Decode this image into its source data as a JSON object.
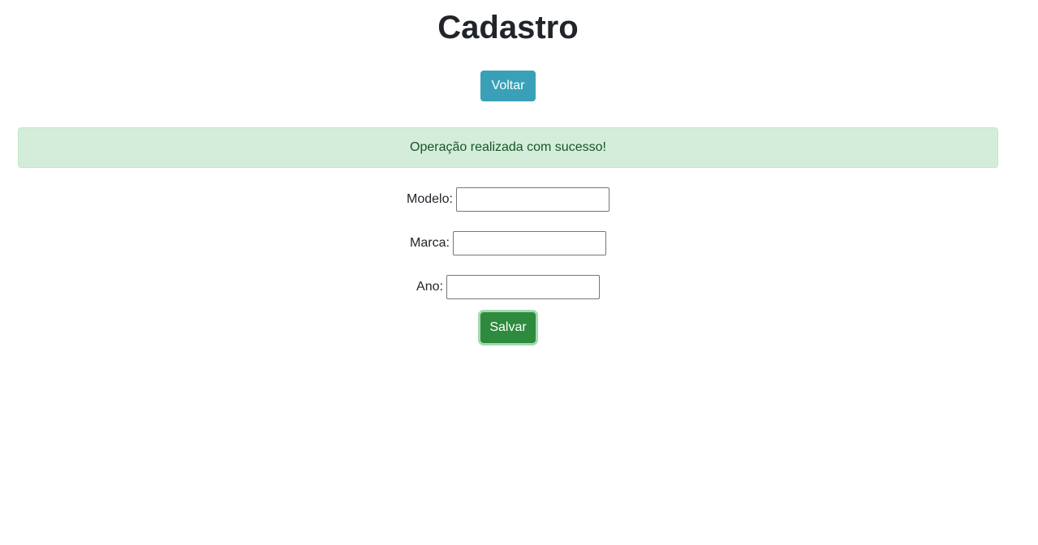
{
  "page": {
    "title": "Cadastro"
  },
  "nav": {
    "back_label": "Voltar"
  },
  "alert": {
    "message": "Operação realizada com sucesso!",
    "type": "success"
  },
  "form": {
    "fields": [
      {
        "label": "Modelo:",
        "value": ""
      },
      {
        "label": "Marca:",
        "value": ""
      },
      {
        "label": "Ano:",
        "value": ""
      }
    ],
    "submit_label": "Salvar"
  },
  "colors": {
    "info_button": "#3aa0b8",
    "success_button": "#2e8a3d",
    "alert_background": "#d4edda",
    "alert_text": "#155724"
  }
}
